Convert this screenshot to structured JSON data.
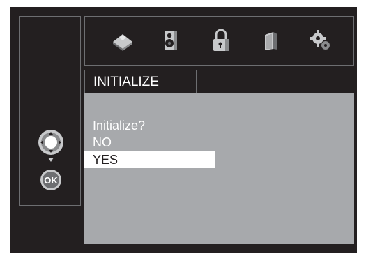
{
  "menu": {
    "tab_title": "INITIALIZE",
    "question": "Initialize?",
    "options": [
      {
        "label": "NO",
        "selected": false
      },
      {
        "label": "YES",
        "selected": true
      }
    ]
  },
  "icons": [
    "language-icon",
    "speaker-icon",
    "lock-icon",
    "books-icon",
    "gear-icon"
  ],
  "remote": {
    "dpad_icon": "dpad-icon",
    "ok_label": "OK"
  },
  "colors": {
    "background": "#231f20",
    "panel": "#a7a9ac",
    "highlight": "#ffffff",
    "border": "#6d6e71"
  }
}
